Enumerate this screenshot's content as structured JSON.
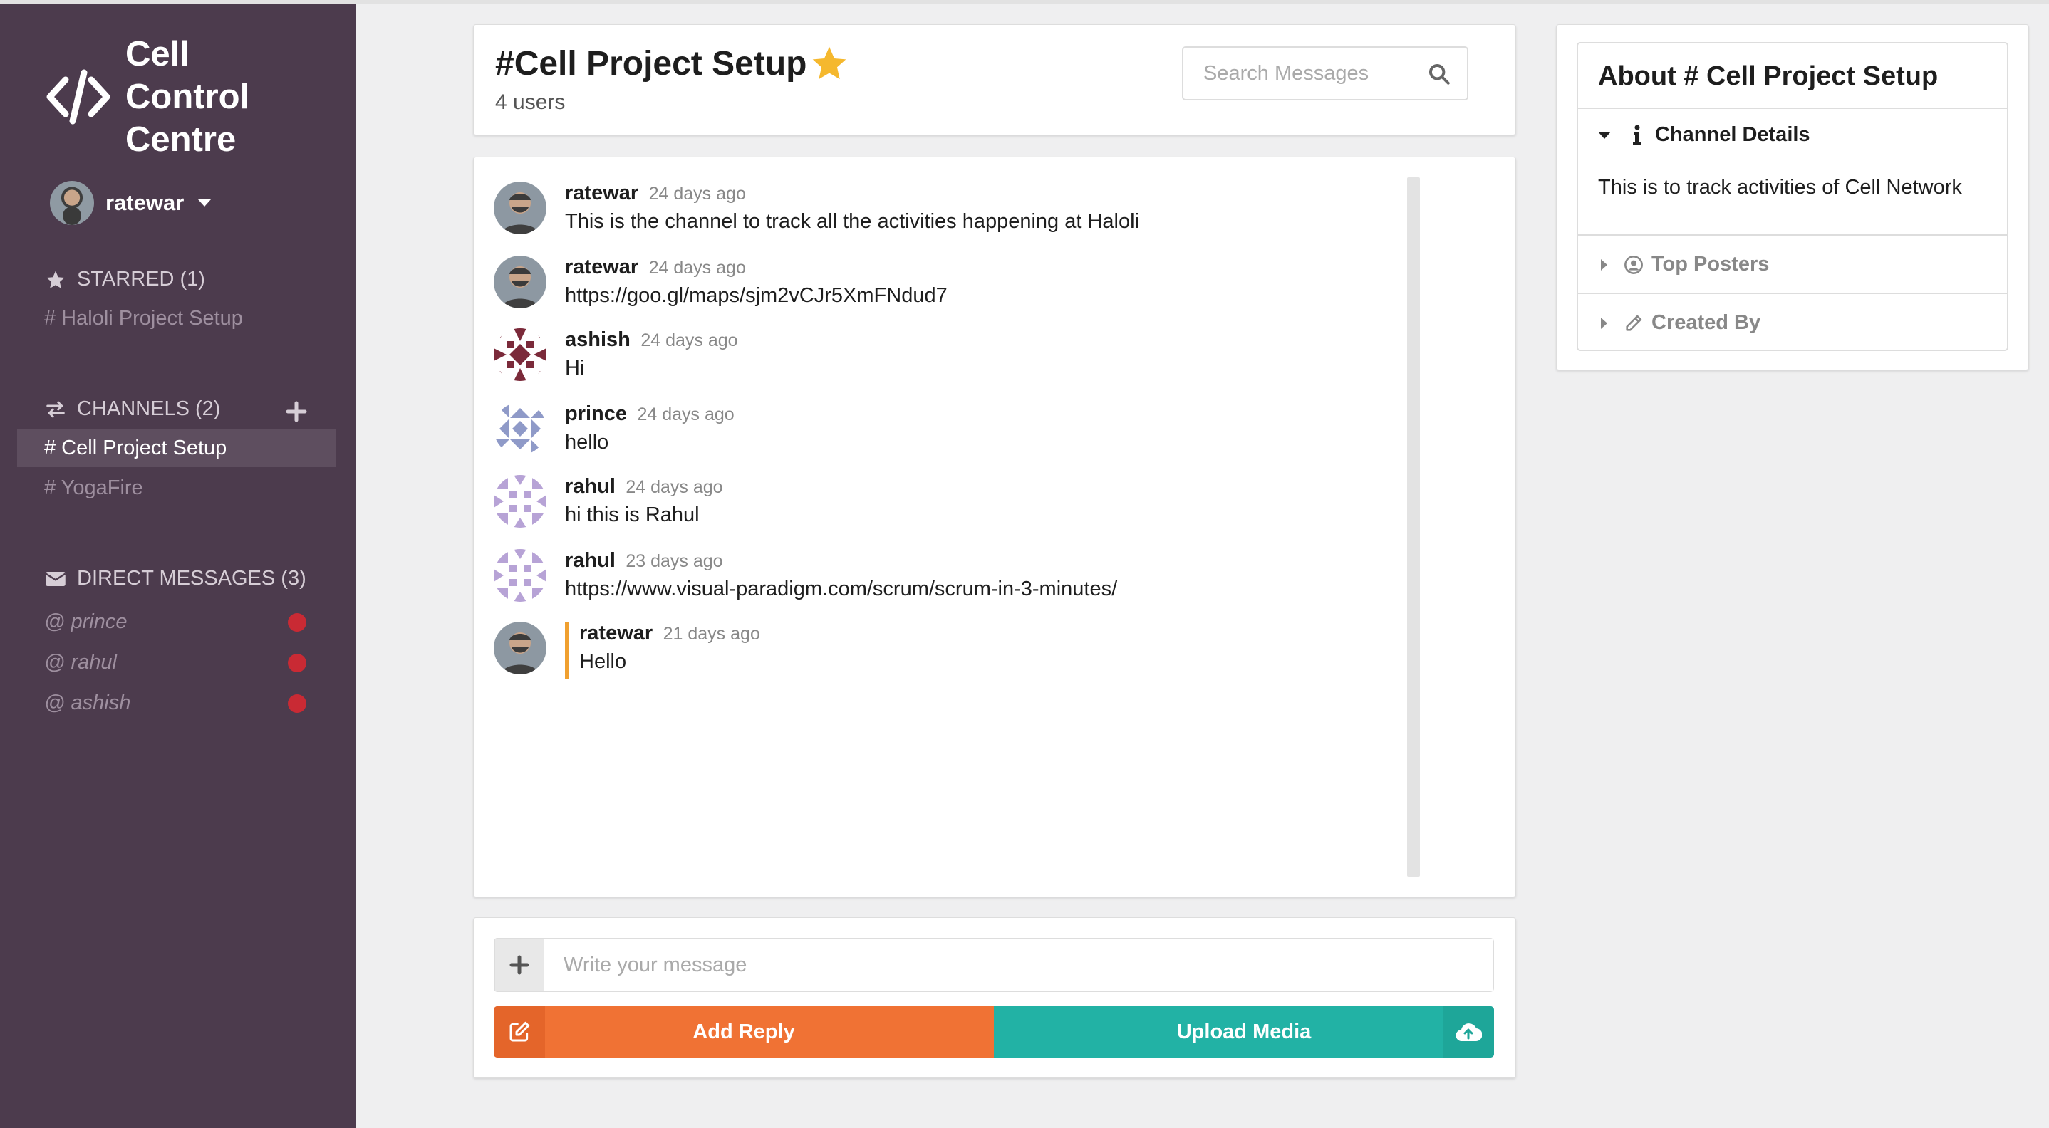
{
  "app": {
    "logo_line1": "Cell",
    "logo_line2": "Control",
    "logo_line3": "Centre"
  },
  "user": {
    "name": "ratewar"
  },
  "sidebar": {
    "starred_header": "STARRED (1)",
    "starred_items": [
      "# Haloli Project Setup"
    ],
    "channels_header": "CHANNELS (2)",
    "channels": [
      "# Cell Project Setup",
      "# YogaFire"
    ],
    "active_channel_index": 0,
    "dm_header": "DIRECT MESSAGES (3)",
    "direct_messages": [
      "@ prince",
      "@ rahul",
      "@ ashish"
    ],
    "dm_status_color": "#c92a34"
  },
  "channel": {
    "title": "#Cell Project Setup",
    "users": "4 users",
    "starred": true
  },
  "search": {
    "placeholder": "Search Messages"
  },
  "messages": [
    {
      "author": "ratewar",
      "time": "24 days ago",
      "text": "This is the channel to track all the activities happening at Haloli",
      "avatar": "photo"
    },
    {
      "author": "ratewar",
      "time": "24 days ago",
      "text": "https://goo.gl/maps/sjm2vCJr5XmFNdud7",
      "avatar": "photo"
    },
    {
      "author": "ashish",
      "time": "24 days ago",
      "text": "Hi",
      "avatar": "identicon-maroon"
    },
    {
      "author": "prince",
      "time": "24 days ago",
      "text": "hello",
      "avatar": "identicon-blue"
    },
    {
      "author": "rahul",
      "time": "24 days ago",
      "text": "hi this is Rahul",
      "avatar": "identicon-lavender"
    },
    {
      "author": "rahul",
      "time": "23 days ago",
      "text": "https://www.visual-paradigm.com/scrum/scrum-in-3-minutes/",
      "avatar": "identicon-lavender"
    },
    {
      "author": "ratewar",
      "time": "21 days ago",
      "text": "Hello",
      "avatar": "photo",
      "reply": true
    }
  ],
  "composer": {
    "placeholder": "Write your message",
    "reply_label": "Add Reply",
    "upload_label": "Upload Media"
  },
  "about": {
    "title": "About # Cell Project Setup",
    "details_label": "Channel Details",
    "description": "This is to track activities of Cell Network",
    "top_posters_label": "Top Posters",
    "created_by_label": "Created By"
  },
  "colors": {
    "sidebar_bg": "#4c3b4d",
    "reply_button": "#f07234",
    "upload_button": "#22b2a5",
    "star": "#f5b82e",
    "reply_accent": "#f0a030"
  },
  "icons": {
    "logo": "code-icon",
    "starred": "star-icon",
    "channels": "exchange-icon",
    "direct_messages": "envelope-icon",
    "search": "search-icon",
    "add": "plus-icon",
    "reply": "edit-icon",
    "upload": "cloud-upload-icon",
    "details": "info-icon",
    "top_posters": "user-circle-icon",
    "created_by": "pencil-icon"
  }
}
